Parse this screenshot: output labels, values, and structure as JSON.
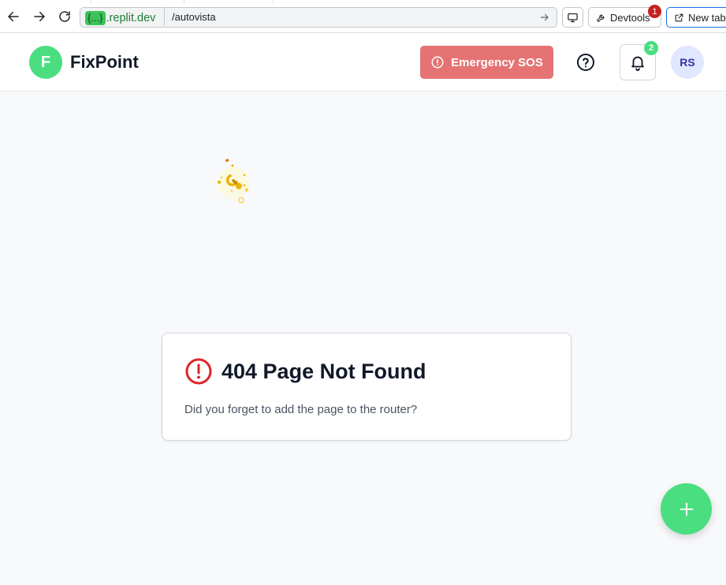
{
  "browser": {
    "origin_braces": "{...}",
    "origin_domain": ".replit.dev",
    "path": "/autovista",
    "devtools_label": "Devtools",
    "devtools_badge": "1",
    "new_tab_label": "New tab"
  },
  "header": {
    "logo_letter": "F",
    "brand": "FixPoint",
    "sos_label": "Emergency SOS",
    "notification_count": "2",
    "avatar_initials": "RS"
  },
  "error_card": {
    "title": "404 Page Not Found",
    "message": "Did you forget to add the page to the router?"
  },
  "icons": {
    "back": "arrow-left-icon",
    "forward": "arrow-right-icon",
    "reload": "reload-icon",
    "go": "go-arrow-icon",
    "screen": "monitor-icon",
    "devtools": "wrench-icon",
    "new_tab": "external-link-icon",
    "sos": "alert-circle-icon",
    "help": "help-circle-icon",
    "bell": "bell-icon",
    "error": "alert-circle-icon",
    "loader": "wrench-spinner-icon",
    "fab": "plus-icon"
  },
  "colors": {
    "brand_green": "#4ade80",
    "sos_red": "#e57373",
    "error_red": "#dc2626",
    "loader_amber": "#eab308",
    "avatar_bg": "#e0e7ff"
  }
}
